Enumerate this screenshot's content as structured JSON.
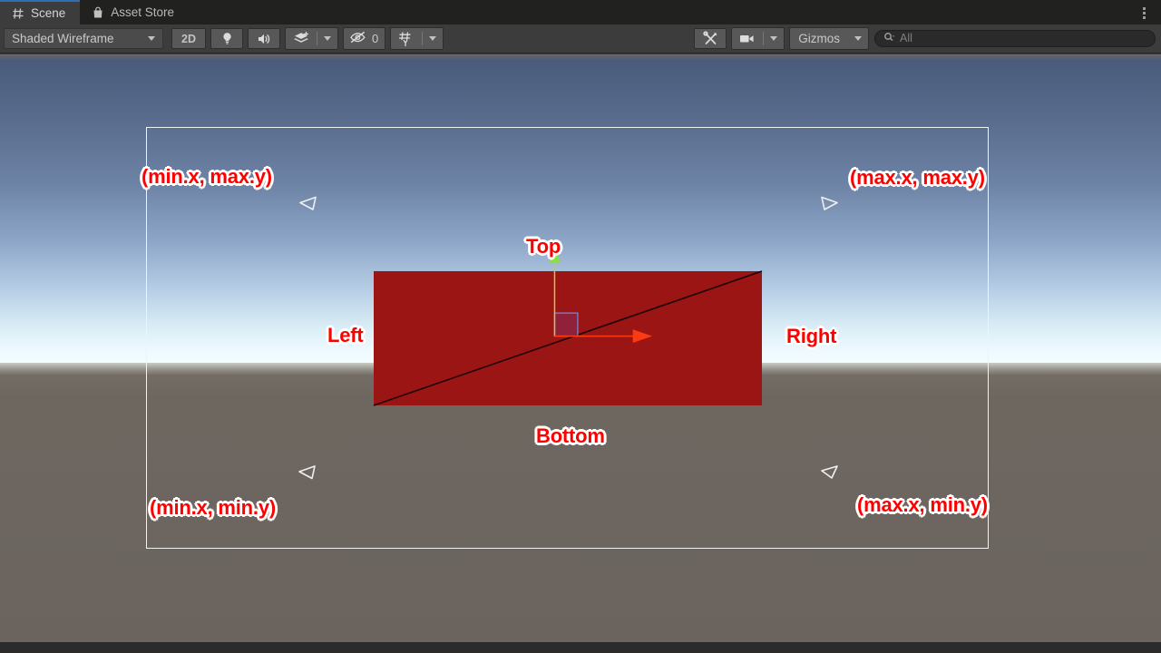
{
  "window": {
    "tabs": [
      {
        "label": "Scene",
        "icon": "grid-icon",
        "active": true
      },
      {
        "label": "Asset Store",
        "icon": "store-bag-icon",
        "active": false
      }
    ],
    "menu_icon": "kebab-menu-icon"
  },
  "toolbar": {
    "draw_mode": "Shaded Wireframe",
    "draw_mode_caret": "chevron-down-icon",
    "button_2d": "2D",
    "lighting_icon": "lightbulb-icon",
    "audio_icon": "speaker-icon",
    "effects_icon": "effects-layers-icon",
    "effects_caret": "chevron-down-icon",
    "hidden_objects_icon": "eye-slash-icon",
    "hidden_objects_count": "0",
    "grid_icon": "grid-axis-y-icon",
    "grid_caret": "chevron-down-icon",
    "tools_icon": "tools-wrench-icon",
    "camera_icon": "camera-icon",
    "camera_caret": "chevron-down-icon",
    "gizmos_label": "Gizmos",
    "gizmos_caret": "chevron-down-icon",
    "search_icon": "search-icon",
    "search_placeholder": "All",
    "search_value": ""
  },
  "scene": {
    "labels": {
      "top_left_corner": "(min.x, max.y)",
      "top_right_corner": "(max.x, max.y)",
      "bottom_left_corner": "(min.x, min.y)",
      "bottom_right_corner": "(max.x, min.y)",
      "top_edge": "Top",
      "left_edge": "Left",
      "right_edge": "Right",
      "bottom_edge": "Bottom"
    },
    "gizmo": {
      "y_axis_name": "y-axis-arrow",
      "x_axis_name": "x-axis-arrow",
      "plane_handle_name": "xy-plane-handle"
    },
    "colors": {
      "quad_fill": "#9c1515",
      "label_text": "#fe0000",
      "label_outline": "#ffffff",
      "bounds_stroke": "#f2f2f2",
      "x_axis": "#fb3b12",
      "y_axis": "#7ee03a",
      "sky_top": "#4a5b7b",
      "ground": "#6e6760"
    }
  }
}
